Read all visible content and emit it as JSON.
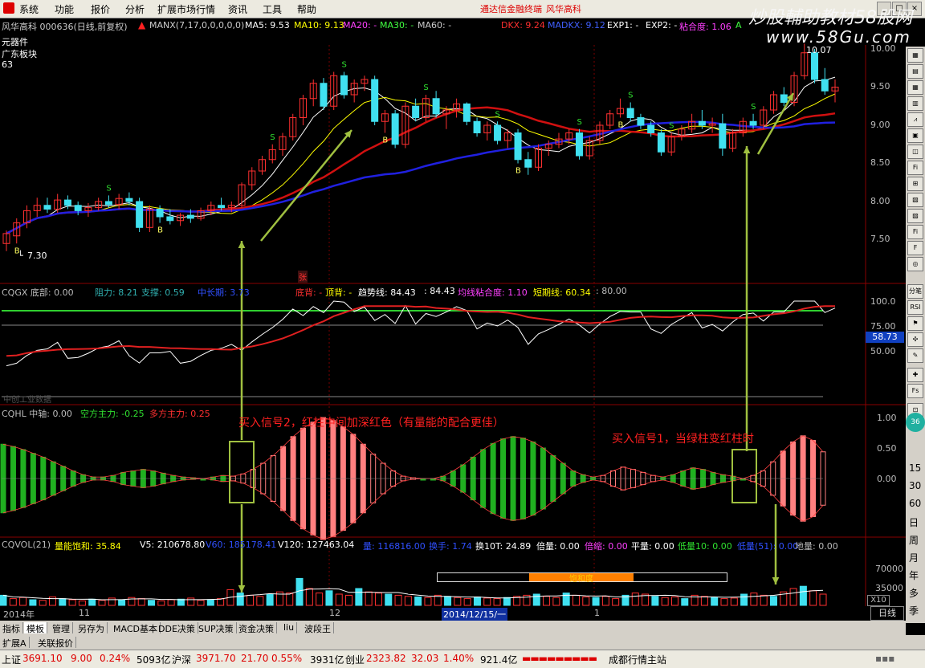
{
  "menu": {
    "items": [
      "系统",
      "功能",
      "报价",
      "分析",
      "扩展市场行情",
      "资讯",
      "工具",
      "帮助"
    ],
    "promo1": "通达信金融终端",
    "promo2": "风华高科",
    "controls": [
      "_",
      "□",
      "×"
    ]
  },
  "watermark": {
    "line1": "炒股輔助教材58股网",
    "line2": "www.58Gu.com"
  },
  "colors": {
    "ma5": "#ffffff",
    "ma10": "#ffff00",
    "ma20": "#d01010",
    "ma60": "#2020e0",
    "up": "#ff3030",
    "down": "#40e0f0",
    "vol_up": "#ff3030",
    "vol_down": "#40e0f0",
    "arrow": "#a0c040",
    "hist_green": "#20b020",
    "hist_red": "#ff8080"
  },
  "header": {
    "stock": "风华高科 000636(日线,前复权)",
    "manx": "MANX(7,17,0,0,0,0,0)",
    "ma5": "MA5: 9.53",
    "ma10": "MA10: 9.13",
    "ma20": "MA20: -",
    "ma30": "MA30: -",
    "ma60": "MA60: -",
    "dkx": "DKX: 9.24",
    "madkx": "MADKX: 9.12",
    "exp1": "EXP1: -",
    "exp2": "EXP2: -",
    "nianhe": "粘合度: 1.06",
    "nianhe_flag": "A",
    "sector1": "元器件",
    "sector2": "广东板块",
    "num": "63"
  },
  "main_chart": {
    "y_ticks": [
      "10.00",
      "9.50",
      "9.00",
      "8.50",
      "8.00",
      "7.50"
    ],
    "high_label": "10.07",
    "low_label": "7.30",
    "candles": [
      {
        "o": 7.45,
        "h": 7.62,
        "l": 7.35,
        "c": 7.58
      },
      {
        "o": 7.55,
        "h": 7.78,
        "l": 7.45,
        "c": 7.72
      },
      {
        "o": 7.72,
        "h": 7.95,
        "l": 7.65,
        "c": 7.88
      },
      {
        "o": 7.88,
        "h": 8.05,
        "l": 7.8,
        "c": 7.95
      },
      {
        "o": 7.95,
        "h": 8.05,
        "l": 7.85,
        "c": 7.9
      },
      {
        "o": 7.9,
        "h": 8.1,
        "l": 7.85,
        "c": 8.02
      },
      {
        "o": 8.02,
        "h": 8.08,
        "l": 7.9,
        "c": 7.95
      },
      {
        "o": 7.95,
        "h": 8.0,
        "l": 7.82,
        "c": 7.88
      },
      {
        "o": 7.88,
        "h": 7.98,
        "l": 7.8,
        "c": 7.92
      },
      {
        "o": 7.92,
        "h": 8.05,
        "l": 7.88,
        "c": 8.0
      },
      {
        "o": 8.0,
        "h": 8.08,
        "l": 7.92,
        "c": 7.96
      },
      {
        "o": 7.96,
        "h": 8.1,
        "l": 7.9,
        "c": 8.04
      },
      {
        "o": 8.04,
        "h": 8.12,
        "l": 7.95,
        "c": 8.0
      },
      {
        "o": 8.0,
        "h": 8.05,
        "l": 7.6,
        "c": 7.66
      },
      {
        "o": 7.66,
        "h": 7.95,
        "l": 7.6,
        "c": 7.9
      },
      {
        "o": 7.9,
        "h": 7.95,
        "l": 7.72,
        "c": 7.8
      },
      {
        "o": 7.8,
        "h": 7.9,
        "l": 7.7,
        "c": 7.75
      },
      {
        "o": 7.75,
        "h": 7.85,
        "l": 7.68,
        "c": 7.82
      },
      {
        "o": 7.82,
        "h": 7.9,
        "l": 7.72,
        "c": 7.78
      },
      {
        "o": 7.78,
        "h": 7.92,
        "l": 7.75,
        "c": 7.88
      },
      {
        "o": 7.88,
        "h": 8.0,
        "l": 7.82,
        "c": 7.95
      },
      {
        "o": 7.95,
        "h": 8.05,
        "l": 7.88,
        "c": 7.92
      },
      {
        "o": 7.92,
        "h": 8.0,
        "l": 7.86,
        "c": 7.95
      },
      {
        "o": 7.95,
        "h": 8.25,
        "l": 7.92,
        "c": 8.22
      },
      {
        "o": 8.22,
        "h": 8.45,
        "l": 8.15,
        "c": 8.4
      },
      {
        "o": 8.4,
        "h": 8.6,
        "l": 8.35,
        "c": 8.55
      },
      {
        "o": 8.55,
        "h": 8.75,
        "l": 8.5,
        "c": 8.68
      },
      {
        "o": 8.68,
        "h": 8.9,
        "l": 8.6,
        "c": 8.85
      },
      {
        "o": 8.85,
        "h": 9.15,
        "l": 8.8,
        "c": 9.1
      },
      {
        "o": 9.1,
        "h": 9.4,
        "l": 9.0,
        "c": 9.35
      },
      {
        "o": 9.35,
        "h": 9.6,
        "l": 9.25,
        "c": 9.55
      },
      {
        "o": 9.55,
        "h": 9.62,
        "l": 9.2,
        "c": 9.25
      },
      {
        "o": 9.25,
        "h": 9.7,
        "l": 9.2,
        "c": 9.65
      },
      {
        "o": 9.65,
        "h": 9.7,
        "l": 9.35,
        "c": 9.4
      },
      {
        "o": 9.4,
        "h": 9.6,
        "l": 9.3,
        "c": 9.55
      },
      {
        "o": 9.55,
        "h": 9.65,
        "l": 9.45,
        "c": 9.6
      },
      {
        "o": 9.6,
        "h": 9.65,
        "l": 9.0,
        "c": 9.05
      },
      {
        "o": 9.05,
        "h": 9.2,
        "l": 8.9,
        "c": 9.15
      },
      {
        "o": 9.15,
        "h": 9.2,
        "l": 8.7,
        "c": 8.75
      },
      {
        "o": 8.75,
        "h": 9.3,
        "l": 8.7,
        "c": 9.25
      },
      {
        "o": 9.25,
        "h": 9.35,
        "l": 9.05,
        "c": 9.1
      },
      {
        "o": 9.1,
        "h": 9.4,
        "l": 9.05,
        "c": 9.35
      },
      {
        "o": 9.35,
        "h": 9.45,
        "l": 9.1,
        "c": 9.15
      },
      {
        "o": 9.15,
        "h": 9.25,
        "l": 8.95,
        "c": 9.2
      },
      {
        "o": 9.2,
        "h": 9.35,
        "l": 9.1,
        "c": 9.28
      },
      {
        "o": 9.28,
        "h": 9.3,
        "l": 9.0,
        "c": 9.05
      },
      {
        "o": 9.05,
        "h": 9.1,
        "l": 8.85,
        "c": 8.9
      },
      {
        "o": 8.9,
        "h": 9.05,
        "l": 8.8,
        "c": 9.0
      },
      {
        "o": 9.0,
        "h": 9.05,
        "l": 8.75,
        "c": 8.8
      },
      {
        "o": 8.8,
        "h": 8.95,
        "l": 8.7,
        "c": 8.9
      },
      {
        "o": 8.9,
        "h": 8.95,
        "l": 8.5,
        "c": 8.55
      },
      {
        "o": 8.55,
        "h": 8.65,
        "l": 8.35,
        "c": 8.45
      },
      {
        "o": 8.45,
        "h": 8.75,
        "l": 8.4,
        "c": 8.7
      },
      {
        "o": 8.7,
        "h": 8.8,
        "l": 8.6,
        "c": 8.75
      },
      {
        "o": 8.75,
        "h": 8.9,
        "l": 8.7,
        "c": 8.82
      },
      {
        "o": 8.82,
        "h": 8.95,
        "l": 8.75,
        "c": 8.9
      },
      {
        "o": 8.9,
        "h": 8.95,
        "l": 8.55,
        "c": 8.6
      },
      {
        "o": 8.6,
        "h": 8.85,
        "l": 8.55,
        "c": 8.8
      },
      {
        "o": 8.8,
        "h": 9.05,
        "l": 8.75,
        "c": 9.0
      },
      {
        "o": 9.0,
        "h": 9.2,
        "l": 8.95,
        "c": 9.15
      },
      {
        "o": 9.15,
        "h": 9.35,
        "l": 9.1,
        "c": 9.22
      },
      {
        "o": 9.22,
        "h": 9.3,
        "l": 9.05,
        "c": 9.1
      },
      {
        "o": 9.1,
        "h": 9.15,
        "l": 8.95,
        "c": 9.0
      },
      {
        "o": 9.0,
        "h": 9.05,
        "l": 8.85,
        "c": 8.9
      },
      {
        "o": 8.9,
        "h": 8.95,
        "l": 8.6,
        "c": 8.65
      },
      {
        "o": 8.65,
        "h": 8.9,
        "l": 8.6,
        "c": 8.85
      },
      {
        "o": 8.85,
        "h": 9.0,
        "l": 8.8,
        "c": 8.95
      },
      {
        "o": 8.95,
        "h": 9.15,
        "l": 8.9,
        "c": 9.05
      },
      {
        "o": 9.05,
        "h": 9.2,
        "l": 8.95,
        "c": 9.0
      },
      {
        "o": 9.0,
        "h": 9.1,
        "l": 8.9,
        "c": 9.02
      },
      {
        "o": 9.02,
        "h": 9.15,
        "l": 8.6,
        "c": 8.7
      },
      {
        "o": 8.7,
        "h": 8.95,
        "l": 8.65,
        "c": 8.9
      },
      {
        "o": 8.9,
        "h": 9.1,
        "l": 8.85,
        "c": 9.05
      },
      {
        "o": 9.05,
        "h": 9.15,
        "l": 8.95,
        "c": 9.0
      },
      {
        "o": 9.0,
        "h": 9.25,
        "l": 8.95,
        "c": 9.2
      },
      {
        "o": 9.2,
        "h": 9.45,
        "l": 9.15,
        "c": 9.4
      },
      {
        "o": 9.4,
        "h": 9.5,
        "l": 9.25,
        "c": 9.3
      },
      {
        "o": 9.3,
        "h": 9.7,
        "l": 9.25,
        "c": 9.65
      },
      {
        "o": 9.65,
        "h": 10.07,
        "l": 9.6,
        "c": 9.95
      },
      {
        "o": 9.95,
        "h": 10.0,
        "l": 9.55,
        "c": 9.6
      },
      {
        "o": 9.6,
        "h": 9.75,
        "l": 9.4,
        "c": 9.45
      },
      {
        "o": 9.45,
        "h": 9.6,
        "l": 9.3,
        "c": 9.5
      }
    ],
    "buy_marker": "B",
    "sell_marker": "S"
  },
  "cqgx": {
    "label": "CQGX 底部: 0.00",
    "zuli": "阻力: 8.21",
    "zhicheng": "支撑: 0.59",
    "zhongchang": "中长期: 3.73",
    "dibei": "底背: -",
    "dingbei": "顶背: -",
    "qushixian": "趋势线: 84.43",
    "val2": ": 84.43",
    "junxian": "均线粘合度: 1.10",
    "duanqi": "短期线: 60.34",
    "val80": ": 80.00",
    "y_ticks": [
      "100.0",
      "75.00",
      "50.00"
    ],
    "current": "58.73",
    "tag": "中创工业数据",
    "zhang": "张"
  },
  "cqhl": {
    "label": "CQHL 中轴: 0.00",
    "kongfang": "空方主力: -0.25",
    "duofang": "多方主力: 0.25",
    "y_ticks": [
      "1.00",
      "0.50",
      "0.00",
      "-0.50"
    ],
    "annotation2": "买入信号2，红柱中间加深红色（有量能的配合更佳）",
    "annotation1": "买入信号1，当绿柱变红柱时",
    "hist": [
      0.45,
      0.42,
      0.38,
      0.33,
      0.28,
      0.22,
      0.16,
      0.1,
      0.05,
      0.02,
      0.02,
      0.04,
      0.08,
      0.1,
      0.12,
      0.1,
      0.07,
      0.04,
      0.02,
      0.01,
      0.0,
      0.02,
      0.04,
      -0.03,
      -0.06,
      -0.12,
      -0.2,
      -0.3,
      -0.42,
      -0.55,
      -0.66,
      -0.74,
      -0.8,
      -0.76,
      -0.68,
      -0.58,
      -0.45,
      -0.32,
      -0.2,
      -0.1,
      -0.03,
      -0.01,
      0.0,
      0.0,
      0.03,
      0.1,
      0.18,
      0.28,
      0.38,
      0.46,
      0.52,
      0.55,
      0.53,
      0.48,
      0.4,
      0.3,
      0.2,
      0.1,
      0.05,
      0.02,
      -0.04,
      -0.1,
      -0.15,
      -0.12,
      -0.08,
      -0.04,
      0.02,
      0.05,
      0.1,
      0.14,
      0.12,
      0.08,
      0.05,
      0.03,
      0.0,
      -0.04,
      -0.1,
      -0.22,
      -0.36,
      -0.48,
      -0.56,
      -0.5,
      -0.35
    ]
  },
  "cqvol": {
    "label": "CQVOL(21)",
    "nengbao": "量能饱和: 35.84",
    "v5": "V5: 210678.80",
    "v60": "V60: 185178.41",
    "v120": "V120: 127463.04",
    "liang": "量: 116816.00",
    "huanshou": "换手: 1.74",
    "huan10": "换10T: 24.89",
    "beiliang": "倍量: 0.00",
    "beisuo": "倍缩: 0.00",
    "pingliang": "平量: 0.00",
    "diliang": "低量10: 0.00",
    "diliang_b": "低量(51): 0.00",
    "dijie": "地量: 0.00",
    "baohedu": "饱和度",
    "y_ticks": [
      "70000",
      "35000"
    ],
    "unit": "X10",
    "vols": [
      18,
      12,
      14,
      10,
      9,
      15,
      12,
      10,
      8,
      11,
      9,
      13,
      10,
      14,
      12,
      9,
      8,
      10,
      11,
      13,
      9,
      10,
      12,
      28,
      22,
      18,
      16,
      20,
      24,
      22,
      48,
      30,
      22,
      26,
      20,
      18,
      30,
      24,
      22,
      20,
      18,
      16,
      15,
      14,
      18,
      16,
      14,
      12,
      15,
      13,
      12,
      14,
      16,
      18,
      20,
      16,
      14,
      22,
      18,
      15,
      14,
      16,
      12,
      18,
      22,
      20,
      16,
      14,
      15,
      12,
      18,
      16,
      14,
      12,
      13,
      20,
      22,
      18,
      16,
      24,
      30,
      34,
      26,
      20
    ]
  },
  "axis": {
    "dates": [
      "2014年",
      "11",
      "12",
      "2014/12/15/一",
      "1"
    ],
    "period": "日线"
  },
  "rightbar": {
    "labels": [
      "分笔",
      "RSI",
      "日",
      "周",
      "月",
      "年",
      "多",
      "季",
      "年"
    ],
    "scales": [
      "15",
      "30",
      "60"
    ]
  },
  "tabs": [
    "指标",
    "模板",
    "管理",
    "另存为",
    "MACD基本",
    "DDE决策",
    "SUP决策",
    "资金决策",
    "liu",
    "波段王"
  ],
  "tabs2": [
    "扩展A",
    "关联报价"
  ],
  "status": {
    "sh_label": "上证",
    "sh_val": "3691.10",
    "sh_chg": "9.00",
    "sh_pct": "0.24%",
    "sh_amt": "5093亿",
    "sz_label": "沪深",
    "sz_val": "3971.70",
    "sz_chg": "21.70",
    "sz_pct": "0.55%",
    "sz_amt": "3931亿",
    "cy_label": "创业",
    "cy_val": "2323.82",
    "cy_chg": "32.03",
    "cy_pct": "1.40%",
    "cy_amt": "921.4亿",
    "site": "成都行情主站"
  }
}
